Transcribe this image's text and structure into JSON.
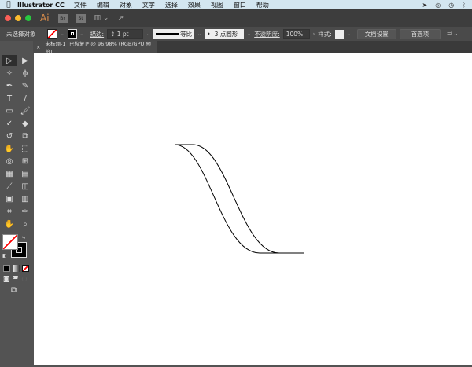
{
  "menubar": {
    "app": "Illustrator CC",
    "items": [
      "文件",
      "编辑",
      "对象",
      "文字",
      "选择",
      "效果",
      "视图",
      "窗口",
      "帮助"
    ]
  },
  "titlebar": {
    "logo": "Ai",
    "bridge": "Br",
    "stock": "St"
  },
  "control": {
    "selection": "未选择对象",
    "stroke_label": "描边:",
    "stroke_weight": "1 pt",
    "profile": "等比",
    "brush": "3 点圆形",
    "opacity_label": "不透明度:",
    "opacity": "100%",
    "style_label": "样式:",
    "doc_setup": "文档设置",
    "prefs": "首选项"
  },
  "tab": {
    "close": "×",
    "title": "未标题-1 [已恢复]* @ 96.98% (RGB/GPU 预览)"
  },
  "tools": [
    {
      "name": "selection-tool-icon",
      "g": "▷"
    },
    {
      "name": "direct-selection-tool-icon",
      "g": "▶"
    },
    {
      "name": "magic-wand-icon",
      "g": "✧"
    },
    {
      "name": "lasso-icon",
      "g": "ϕ"
    },
    {
      "name": "pen-tool-icon",
      "g": "✒"
    },
    {
      "name": "curvature-tool-icon",
      "g": "✎"
    },
    {
      "name": "type-tool-icon",
      "g": "T"
    },
    {
      "name": "line-tool-icon",
      "g": "/"
    },
    {
      "name": "rectangle-tool-icon",
      "g": "▭"
    },
    {
      "name": "paintbrush-icon",
      "g": "🖌"
    },
    {
      "name": "shaper-tool-icon",
      "g": "✓"
    },
    {
      "name": "eraser-icon",
      "g": "◆"
    },
    {
      "name": "rotate-tool-icon",
      "g": "↺"
    },
    {
      "name": "scale-tool-icon",
      "g": "⧉"
    },
    {
      "name": "warp-tool-icon",
      "g": "✋"
    },
    {
      "name": "free-transform-icon",
      "g": "⬚"
    },
    {
      "name": "shape-builder-icon",
      "g": "◎"
    },
    {
      "name": "perspective-grid-icon",
      "g": "⊞"
    },
    {
      "name": "mesh-tool-icon",
      "g": "▦"
    },
    {
      "name": "gradient-tool-icon",
      "g": "▤"
    },
    {
      "name": "eyedropper-icon",
      "g": "⟋"
    },
    {
      "name": "blend-tool-icon",
      "g": "◫"
    },
    {
      "name": "symbol-sprayer-icon",
      "g": "▣"
    },
    {
      "name": "graph-tool-icon",
      "g": "▥"
    },
    {
      "name": "artboard-tool-icon",
      "g": "⌗"
    },
    {
      "name": "slice-tool-icon",
      "g": "✑"
    },
    {
      "name": "hand-tool-icon",
      "g": "✋"
    },
    {
      "name": "zoom-tool-icon",
      "g": "⌕"
    }
  ]
}
